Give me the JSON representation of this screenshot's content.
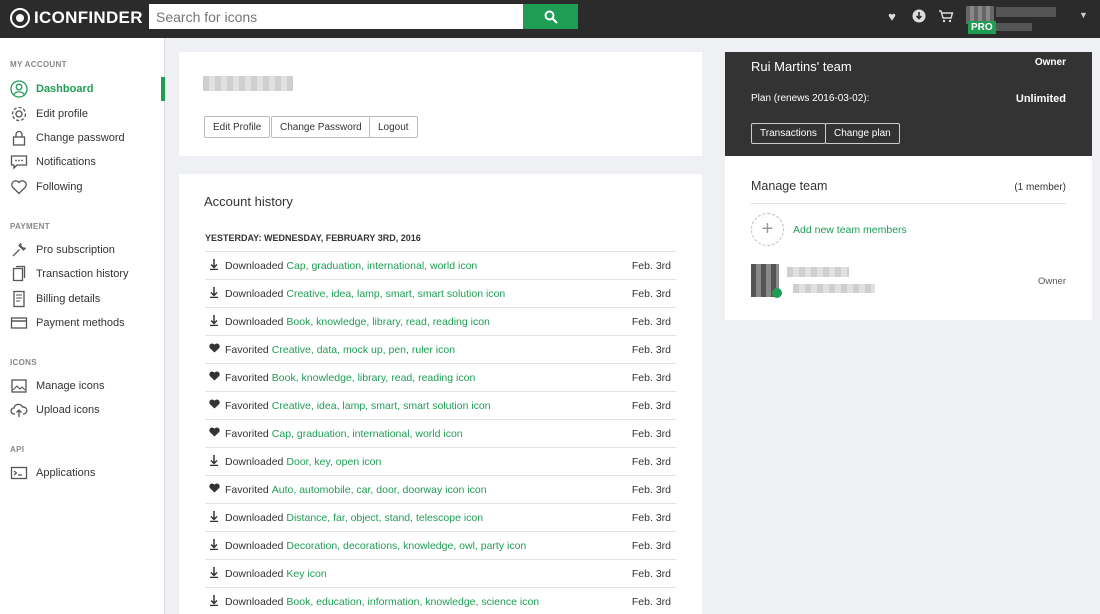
{
  "header": {
    "logo_text": "ICONFINDER",
    "search_placeholder": "Search for icons",
    "pro_badge": "PRO"
  },
  "sidebar": {
    "sections": [
      {
        "title": "MY ACCOUNT",
        "items": [
          {
            "label": "Dashboard",
            "icon": "user-circle-icon",
            "active": true
          },
          {
            "label": "Edit profile",
            "icon": "gear-icon"
          },
          {
            "label": "Change password",
            "icon": "lock-icon"
          },
          {
            "label": "Notifications",
            "icon": "chat-bubble-icon"
          },
          {
            "label": "Following",
            "icon": "heart-icon"
          }
        ]
      },
      {
        "title": "PAYMENT",
        "items": [
          {
            "label": "Pro subscription",
            "icon": "wrench-icon"
          },
          {
            "label": "Transaction history",
            "icon": "documents-icon"
          },
          {
            "label": "Billing details",
            "icon": "invoice-icon"
          },
          {
            "label": "Payment methods",
            "icon": "credit-card-icon"
          }
        ]
      },
      {
        "title": "ICONS",
        "items": [
          {
            "label": "Manage icons",
            "icon": "image-gallery-icon"
          },
          {
            "label": "Upload icons",
            "icon": "cloud-upload-icon"
          }
        ]
      },
      {
        "title": "API",
        "items": [
          {
            "label": "Applications",
            "icon": "terminal-icon"
          }
        ]
      }
    ]
  },
  "profile": {
    "edit_profile": "Edit Profile",
    "change_password": "Change Password",
    "logout": "Logout"
  },
  "history": {
    "title": "Account history",
    "day_header": "YESTERDAY: WEDNESDAY, FEBRUARY 3RD, 2016",
    "rows": [
      {
        "type": "download",
        "action": "Downloaded",
        "link": "Cap, graduation, international, world icon",
        "date": "Feb. 3rd"
      },
      {
        "type": "download",
        "action": "Downloaded",
        "link": "Creative, idea, lamp, smart, smart solution icon",
        "date": "Feb. 3rd"
      },
      {
        "type": "download",
        "action": "Downloaded",
        "link": "Book, knowledge, library, read, reading icon",
        "date": "Feb. 3rd"
      },
      {
        "type": "favorite",
        "action": "Favorited",
        "link": "Creative, data, mock up, pen, ruler icon",
        "date": "Feb. 3rd"
      },
      {
        "type": "favorite",
        "action": "Favorited",
        "link": "Book, knowledge, library, read, reading icon",
        "date": "Feb. 3rd"
      },
      {
        "type": "favorite",
        "action": "Favorited",
        "link": "Creative, idea, lamp, smart, smart solution icon",
        "date": "Feb. 3rd"
      },
      {
        "type": "favorite",
        "action": "Favorited",
        "link": "Cap, graduation, international, world icon",
        "date": "Feb. 3rd"
      },
      {
        "type": "download",
        "action": "Downloaded",
        "link": "Door, key, open icon",
        "date": "Feb. 3rd"
      },
      {
        "type": "favorite",
        "action": "Favorited",
        "link": "Auto, automobile, car, door, doorway icon icon",
        "date": "Feb. 3rd"
      },
      {
        "type": "download",
        "action": "Downloaded",
        "link": "Distance, far, object, stand, telescope icon",
        "date": "Feb. 3rd"
      },
      {
        "type": "download",
        "action": "Downloaded",
        "link": "Decoration, decorations, knowledge, owl, party icon",
        "date": "Feb. 3rd"
      },
      {
        "type": "download",
        "action": "Downloaded",
        "link": "Key icon",
        "date": "Feb. 3rd"
      },
      {
        "type": "download",
        "action": "Downloaded",
        "link": "Book, education, information, knowledge, science icon",
        "date": "Feb. 3rd"
      }
    ]
  },
  "team": {
    "name": "Rui Martins' team",
    "role": "Owner",
    "plan_label": "Plan (renews 2016-03-02):",
    "plan_value": "Unlimited",
    "transactions": "Transactions",
    "change_plan": "Change plan",
    "manage_title": "Manage team",
    "member_count": "(1 member)",
    "add_members": "Add new team members",
    "member_role": "Owner"
  },
  "colors": {
    "accent": "#1f9d55",
    "topbar": "#2b2b2b",
    "team_header": "#333333"
  }
}
